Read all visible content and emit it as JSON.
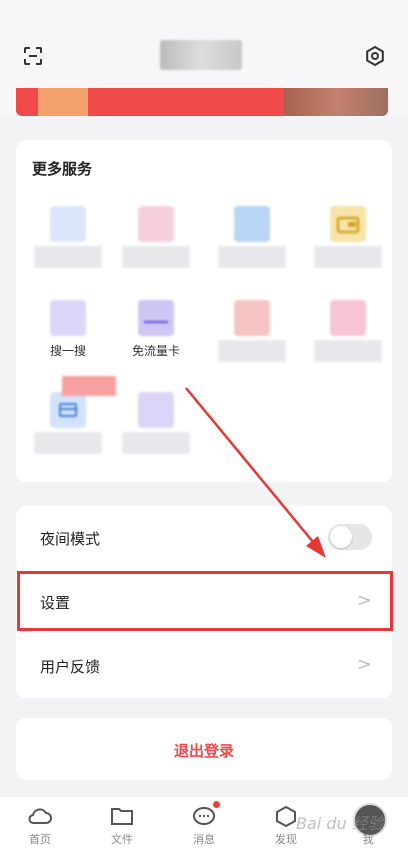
{
  "header": {
    "title_obscured": ""
  },
  "services": {
    "title": "更多服务",
    "items": [
      {
        "label": "",
        "icon": "blurred-app-icon",
        "color": "#dbe7fb"
      },
      {
        "label": "",
        "icon": "blurred-app-icon",
        "color": "#f6d0da"
      },
      {
        "label": "",
        "icon": "blurred-app-icon",
        "color": "#b9d6f7"
      },
      {
        "label": "",
        "icon": "wallet-icon",
        "color": "#f6e4a8"
      },
      {
        "label": "搜一搜",
        "icon": "search-icon",
        "color": "#dcd6f8"
      },
      {
        "label": "免流量卡",
        "icon": "card-icon",
        "color": "#cfc5f4"
      },
      {
        "label": "",
        "icon": "blurred-app-icon",
        "color": "#f7c4c4"
      },
      {
        "label": "",
        "icon": "blurred-app-icon",
        "color": "#f7c4d6"
      },
      {
        "label": "",
        "icon": "box-icon",
        "color": "#d3e3fb"
      },
      {
        "label": "",
        "icon": "blurred-app-icon",
        "color": "#ddd5f8"
      }
    ]
  },
  "settings_list": {
    "night_mode": {
      "label": "夜间模式",
      "enabled": false
    },
    "settings": {
      "label": "设置",
      "chevron": ">"
    },
    "feedback": {
      "label": "用户反馈",
      "chevron": ">"
    }
  },
  "logout": {
    "label": "退出登录"
  },
  "tabbar": {
    "tabs": [
      {
        "label": "首页",
        "icon": "cloud-icon"
      },
      {
        "label": "文件",
        "icon": "folder-icon"
      },
      {
        "label": "消息",
        "icon": "message-icon",
        "badge": true
      },
      {
        "label": "发现",
        "icon": "discover-icon"
      },
      {
        "label": "我",
        "icon": "avatar-icon"
      }
    ]
  },
  "watermark": "Bai du 经验",
  "colors": {
    "accent": "#ef4a4a",
    "highlight": "#e53935"
  }
}
